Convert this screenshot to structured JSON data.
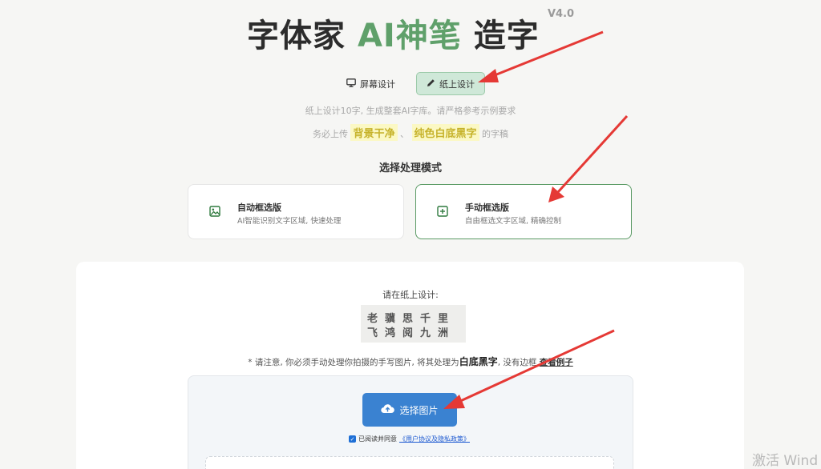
{
  "header": {
    "title_a": "字体家 ",
    "title_ai": "AI神笔",
    "title_b": " 造字",
    "version": "V4.0"
  },
  "mode_tabs": [
    {
      "label": "屏幕设计",
      "icon": "monitor-icon",
      "active": false
    },
    {
      "label": "纸上设计",
      "icon": "pencil-icon",
      "active": true
    }
  ],
  "hint": {
    "line1": "纸上设计10字, 生成整套AI字库。请严格参考示例要求",
    "line2_prefix": "务必上传",
    "highlight1": "背景干净",
    "separator": "、",
    "highlight2": "纯色白底黑字",
    "line2_suffix": "的字稿"
  },
  "section_title": "选择处理模式",
  "mode_cards": [
    {
      "title": "自动框选版",
      "subtitle": "AI智能识别文字区域, 快速处理",
      "icon": "image-icon",
      "selected": false
    },
    {
      "title": "手动框选版",
      "subtitle": "自由框选文字区域, 精确控制",
      "icon": "plus-square-icon",
      "selected": true
    }
  ],
  "panel": {
    "label": "请在纸上设计:",
    "sample_row1": "老骥思千里",
    "sample_row2": "飞鸿阅九洲",
    "notice_prefix": "* 请注意, 你必须手动处理你拍摄的手写图片, 将其处理为",
    "notice_bold": "白底黑字",
    "notice_middle": ", 没有边框",
    "notice_link": "查看例子",
    "upload_label": "选择图片",
    "agree_text": "已阅读并同意",
    "agree_link": "《用户协议及隐私政策》"
  },
  "watermark": "激活 Wind",
  "colors": {
    "accent_green": "#5fa06a",
    "upload_blue": "#3a82d1",
    "highlight_yellow": "#fbf8c4",
    "arrow_red": "#e53935"
  }
}
